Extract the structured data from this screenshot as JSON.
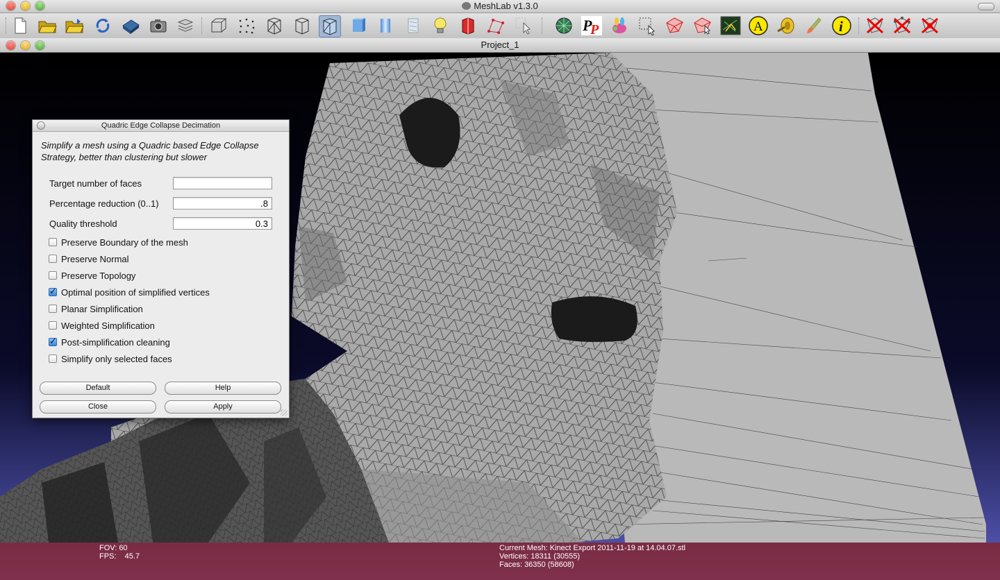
{
  "app": {
    "title": "MeshLab v1.3.0"
  },
  "document": {
    "title": "Project_1"
  },
  "toolbar": {
    "items": [
      {
        "icon": "new-document-icon"
      },
      {
        "icon": "open-folder-icon"
      },
      {
        "icon": "import-folder-icon"
      },
      {
        "icon": "reload-icon"
      },
      {
        "icon": "save-disk-icon"
      },
      {
        "icon": "snapshot-camera-icon"
      },
      {
        "icon": "layers-icon"
      },
      {
        "icon": "bounding-box-icon"
      },
      {
        "icon": "points-icon"
      },
      {
        "icon": "wireframe-icon"
      },
      {
        "icon": "hidden-lines-icon"
      },
      {
        "icon": "flat-lines-icon"
      },
      {
        "icon": "flat-shading-icon"
      },
      {
        "icon": "smooth-shading-icon"
      },
      {
        "icon": "texture-icon"
      },
      {
        "icon": "light-bulb-icon"
      },
      {
        "icon": "backface-icon"
      },
      {
        "icon": "select-vertices-icon"
      },
      {
        "icon": "pointer-select-icon"
      },
      {
        "icon": "mesh-sphere-icon"
      },
      {
        "icon": "pp-icon"
      },
      {
        "icon": "paint-bunny-icon"
      },
      {
        "icon": "select-rect-icon"
      },
      {
        "icon": "select-faces-icon"
      },
      {
        "icon": "select-vertices-paint-icon"
      },
      {
        "icon": "align-icon"
      },
      {
        "icon": "annotate-a-icon"
      },
      {
        "icon": "measure-icon"
      },
      {
        "icon": "brush-icon"
      },
      {
        "icon": "info-icon"
      },
      {
        "icon": "delete-faces-icon"
      },
      {
        "icon": "delete-vertices-icon"
      },
      {
        "icon": "delete-all-icon"
      }
    ]
  },
  "dialog": {
    "title": "Quadric Edge Collapse Decimation",
    "description": "Simplify a mesh using a Quadric based Edge Collapse Strategy, better than clustering but slower",
    "params": [
      {
        "label": "Target number of faces",
        "value": ""
      },
      {
        "label": "Percentage reduction (0..1)",
        "value": ".8"
      },
      {
        "label": "Quality threshold",
        "value": "0.3"
      }
    ],
    "checks": [
      {
        "label": "Preserve Boundary of the mesh",
        "checked": false
      },
      {
        "label": "Preserve Normal",
        "checked": false
      },
      {
        "label": "Preserve Topology",
        "checked": false
      },
      {
        "label": "Optimal position of simplified vertices",
        "checked": true
      },
      {
        "label": "Planar Simplification",
        "checked": false
      },
      {
        "label": "Weighted Simplification",
        "checked": false
      },
      {
        "label": "Post-simplification cleaning",
        "checked": true
      },
      {
        "label": "Simplify only selected faces",
        "checked": false
      }
    ],
    "buttons": {
      "default": "Default",
      "help": "Help",
      "close": "Close",
      "apply": "Apply"
    }
  },
  "status": {
    "fov": "FOV: 60",
    "fps": "FPS:    45.7",
    "current_mesh": "Current Mesh: Kinect Export 2011-11-19 at 14.04.07.stl",
    "vertices": "Vertices: 18311 (30555)",
    "faces": "Faces: 36350 (58608)"
  },
  "colors": {
    "accent_check": "#3a84d8",
    "status_bar": "#8c1e1e",
    "background_bottom": "#5a5dbd",
    "mesh": "#a8a8a8"
  }
}
